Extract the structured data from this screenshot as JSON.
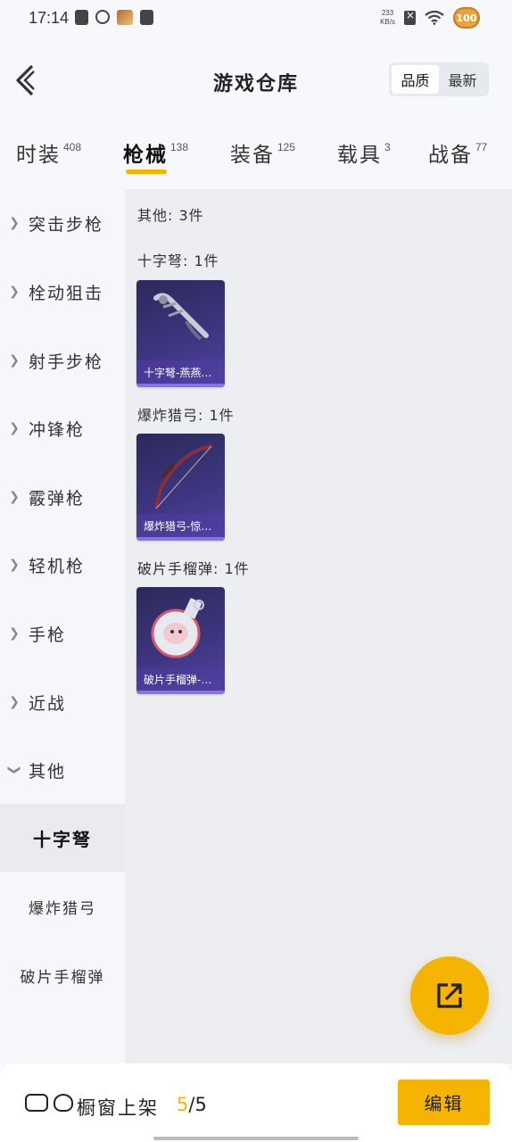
{
  "status_bar": {
    "time": "17:14",
    "net_speed_value": "233",
    "net_speed_unit": "KB/s",
    "battery": "100"
  },
  "header": {
    "title": "游戏仓库",
    "sort_options": [
      "品质",
      "最新"
    ],
    "active_sort": "品质"
  },
  "tabs": [
    {
      "label": "时装",
      "count": "408"
    },
    {
      "label": "枪械",
      "count": "138"
    },
    {
      "label": "装备",
      "count": "125"
    },
    {
      "label": "载具",
      "count": "3"
    },
    {
      "label": "战备",
      "count": "77"
    }
  ],
  "active_tab": "枪械",
  "sidebar": {
    "categories": [
      "突击步枪",
      "栓动狙击",
      "射手步枪",
      "冲锋枪",
      "霰弹枪",
      "轻机枪",
      "手枪",
      "近战",
      "其他"
    ],
    "expanded_category": "其他",
    "subcategories": [
      "十字弩",
      "爆炸猎弓",
      "破片手榴弹"
    ],
    "active_subcategory": "十字弩"
  },
  "content": {
    "summary": "其他: 3件",
    "groups": [
      {
        "label": "十字弩: 1件",
        "item_caption": "十字弩-燕燕…"
      },
      {
        "label": "爆炸猎弓: 1件",
        "item_caption": "爆炸猎弓-惊…"
      },
      {
        "label": "破片手榴弹: 1件",
        "item_caption": "破片手榴弹-…"
      }
    ]
  },
  "bottom_bar": {
    "showcase_label": "橱窗上架",
    "showcase_current": "5",
    "showcase_total": "/5",
    "edit_label": "编辑"
  },
  "colors": {
    "accent": "#f5b400",
    "card_bg": "#3d3580",
    "card_stripe": "#8a72e6"
  }
}
